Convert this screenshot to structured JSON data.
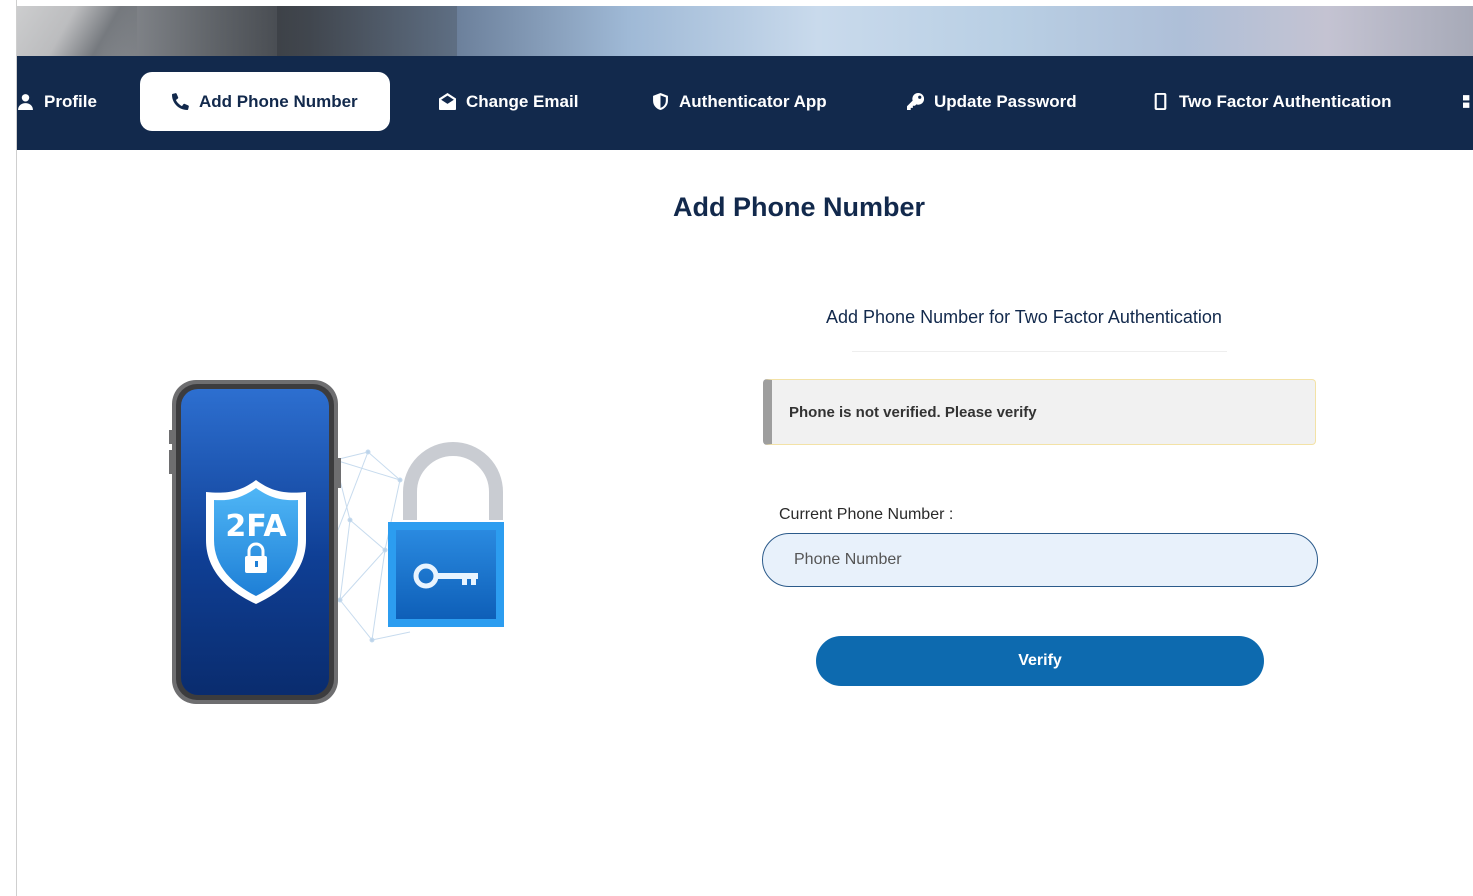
{
  "nav": {
    "items": [
      {
        "label": "Profile",
        "icon": "user-icon",
        "active": false
      },
      {
        "label": "Add Phone Number",
        "icon": "phone-icon",
        "active": true
      },
      {
        "label": "Change Email",
        "icon": "envelope-open-icon",
        "active": false
      },
      {
        "label": "Authenticator App",
        "icon": "shield-icon",
        "active": false
      },
      {
        "label": "Update Password",
        "icon": "key-icon",
        "active": false
      },
      {
        "label": "Two Factor Authentication",
        "icon": "mobile-icon",
        "active": false
      }
    ]
  },
  "main": {
    "title": "Add Phone Number",
    "subtitle": "Add Phone Number for Two Factor Authentication",
    "alert": "Phone is not verified. Please verify",
    "phone_label": "Current Phone Number :",
    "phone_placeholder": "Phone Number",
    "phone_value": "",
    "verify_label": "Verify"
  },
  "illustration": {
    "shield_text": "2FA"
  },
  "colors": {
    "navbar": "#12294c",
    "primary_button": "#0d6aaf",
    "input_bg": "#e8f1fb",
    "alert_bg": "#f1f1f1"
  }
}
